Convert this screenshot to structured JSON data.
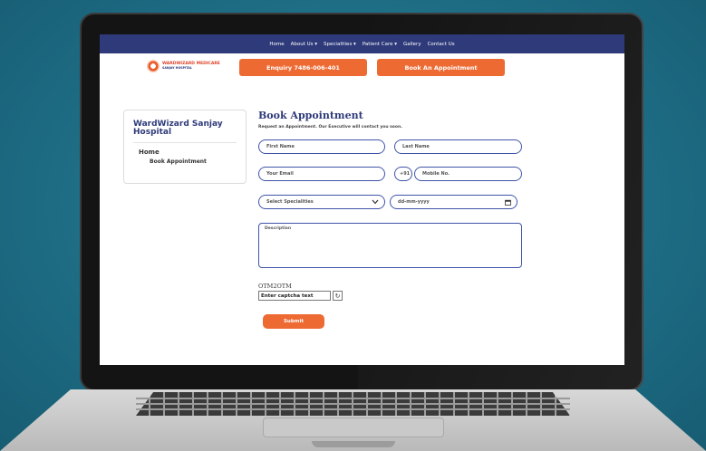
{
  "nav": {
    "items": [
      "Home",
      "About Us ▾",
      "Specialities ▾",
      "Patient Care ▾",
      "Gallery",
      "Contact Us"
    ]
  },
  "header": {
    "logo_line1": "WARDWIZARD MEDICARE",
    "logo_line2": "SANJAY HOSPITAL",
    "enquiry_label": "Enquiry 7486-006-401",
    "book_label": "Book An Appointment"
  },
  "sidebar": {
    "title": "WardWizard Sanjay Hospital",
    "home": "Home",
    "current": "Book Appointment"
  },
  "form": {
    "title": "Book Appointment",
    "subtitle": "Request an Appointment. Our Executive will contact you soon.",
    "first_name_placeholder": "First Name",
    "last_name_placeholder": "Last Name",
    "email_placeholder": "Your Email",
    "country_code": "+91",
    "mobile_placeholder": "Mobile No.",
    "speciality_placeholder": "Select Specialities",
    "date_placeholder": "dd-mm-yyyy",
    "description_placeholder": "Description",
    "captcha_code": "OTM2OTM",
    "captcha_placeholder": "Enter captcha text",
    "submit_label": "Submit"
  },
  "colors": {
    "nav_bg": "#2e3a7a",
    "accent_orange": "#ee6a33",
    "field_border": "#3f54a8",
    "background_teal": "#1e6e86"
  }
}
